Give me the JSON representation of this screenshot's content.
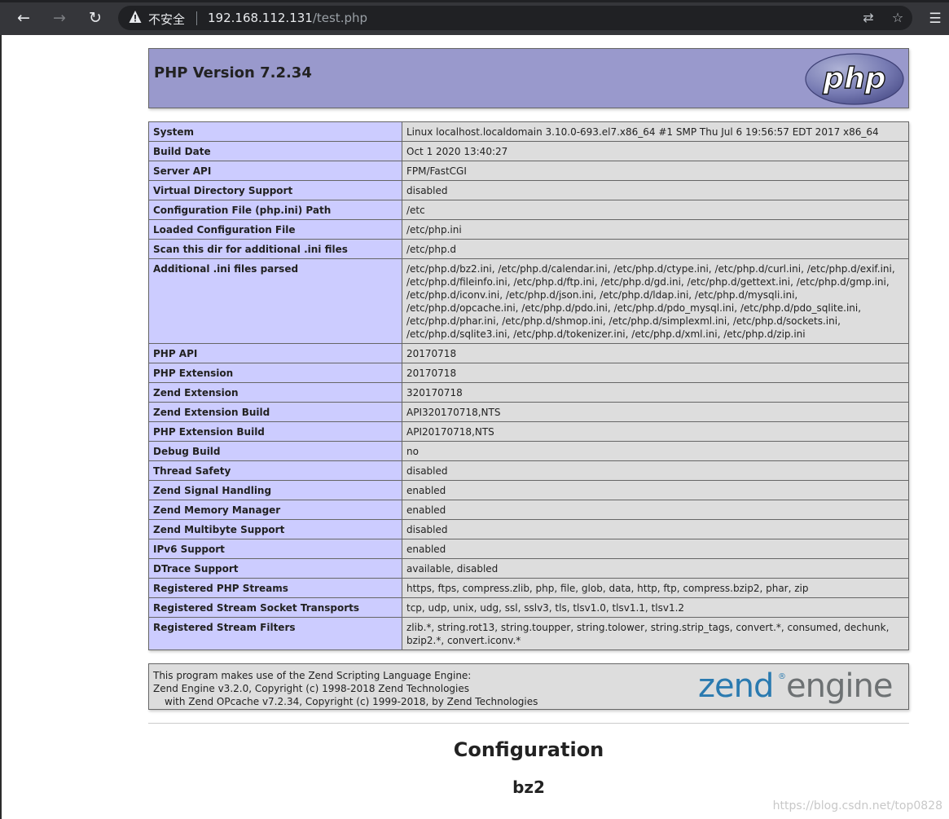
{
  "browser": {
    "back_glyph": "←",
    "forward_glyph": "→",
    "reload_glyph": "↻",
    "security_label": "不安全",
    "url_host": "192.168.112.131",
    "url_path": "/test.php",
    "translate_glyph": "⇄",
    "star_glyph": "☆",
    "menu_glyph": "☰"
  },
  "header": {
    "title": "PHP Version 7.2.34",
    "logo_text": "php"
  },
  "info_rows": [
    {
      "key": "System",
      "value": "Linux localhost.localdomain 3.10.0-693.el7.x86_64 #1 SMP Thu Jul 6 19:56:57 EDT 2017 x86_64"
    },
    {
      "key": "Build Date",
      "value": "Oct 1 2020 13:40:27"
    },
    {
      "key": "Server API",
      "value": "FPM/FastCGI"
    },
    {
      "key": "Virtual Directory Support",
      "value": "disabled"
    },
    {
      "key": "Configuration File (php.ini) Path",
      "value": "/etc"
    },
    {
      "key": "Loaded Configuration File",
      "value": "/etc/php.ini"
    },
    {
      "key": "Scan this dir for additional .ini files",
      "value": "/etc/php.d"
    },
    {
      "key": "Additional .ini files parsed",
      "value": "/etc/php.d/bz2.ini, /etc/php.d/calendar.ini, /etc/php.d/ctype.ini, /etc/php.d/curl.ini, /etc/php.d/exif.ini, /etc/php.d/fileinfo.ini, /etc/php.d/ftp.ini, /etc/php.d/gd.ini, /etc/php.d/gettext.ini, /etc/php.d/gmp.ini, /etc/php.d/iconv.ini, /etc/php.d/json.ini, /etc/php.d/ldap.ini, /etc/php.d/mysqli.ini, /etc/php.d/opcache.ini, /etc/php.d/pdo.ini, /etc/php.d/pdo_mysql.ini, /etc/php.d/pdo_sqlite.ini, /etc/php.d/phar.ini, /etc/php.d/shmop.ini, /etc/php.d/simplexml.ini, /etc/php.d/sockets.ini, /etc/php.d/sqlite3.ini, /etc/php.d/tokenizer.ini, /etc/php.d/xml.ini, /etc/php.d/zip.ini"
    },
    {
      "key": "PHP API",
      "value": "20170718"
    },
    {
      "key": "PHP Extension",
      "value": "20170718"
    },
    {
      "key": "Zend Extension",
      "value": "320170718"
    },
    {
      "key": "Zend Extension Build",
      "value": "API320170718,NTS"
    },
    {
      "key": "PHP Extension Build",
      "value": "API20170718,NTS"
    },
    {
      "key": "Debug Build",
      "value": "no"
    },
    {
      "key": "Thread Safety",
      "value": "disabled"
    },
    {
      "key": "Zend Signal Handling",
      "value": "enabled"
    },
    {
      "key": "Zend Memory Manager",
      "value": "enabled"
    },
    {
      "key": "Zend Multibyte Support",
      "value": "disabled"
    },
    {
      "key": "IPv6 Support",
      "value": "enabled"
    },
    {
      "key": "DTrace Support",
      "value": "available, disabled"
    },
    {
      "key": "Registered PHP Streams",
      "value": "https, ftps, compress.zlib, php, file, glob, data, http, ftp, compress.bzip2, phar, zip"
    },
    {
      "key": "Registered Stream Socket Transports",
      "value": "tcp, udp, unix, udg, ssl, sslv3, tls, tlsv1.0, tlsv1.1, tlsv1.2"
    },
    {
      "key": "Registered Stream Filters",
      "value": "zlib.*, string.rot13, string.toupper, string.tolower, string.strip_tags, convert.*, consumed, dechunk, bzip2.*, convert.iconv.*"
    }
  ],
  "zend": {
    "line1": "This program makes use of the Zend Scripting Language Engine:",
    "line2": "Zend Engine v3.2.0, Copyright (c) 1998-2018 Zend Technologies",
    "line3": "with Zend OPcache v7.2.34, Copyright (c) 1999-2018, by Zend Technologies",
    "logo_zend": "zend",
    "logo_reg": "®",
    "logo_engine": "engine"
  },
  "sections": {
    "configuration_heading": "Configuration",
    "module_heading": "bz2"
  },
  "watermark": "https://blog.csdn.net/top0828",
  "colors": {
    "header_bg": "#9999cc",
    "key_bg": "#ccccff",
    "value_bg": "#dddddd",
    "chrome_bg": "#35363a",
    "zend_blue": "#2a7ab0",
    "zend_gray": "#6d7173"
  }
}
